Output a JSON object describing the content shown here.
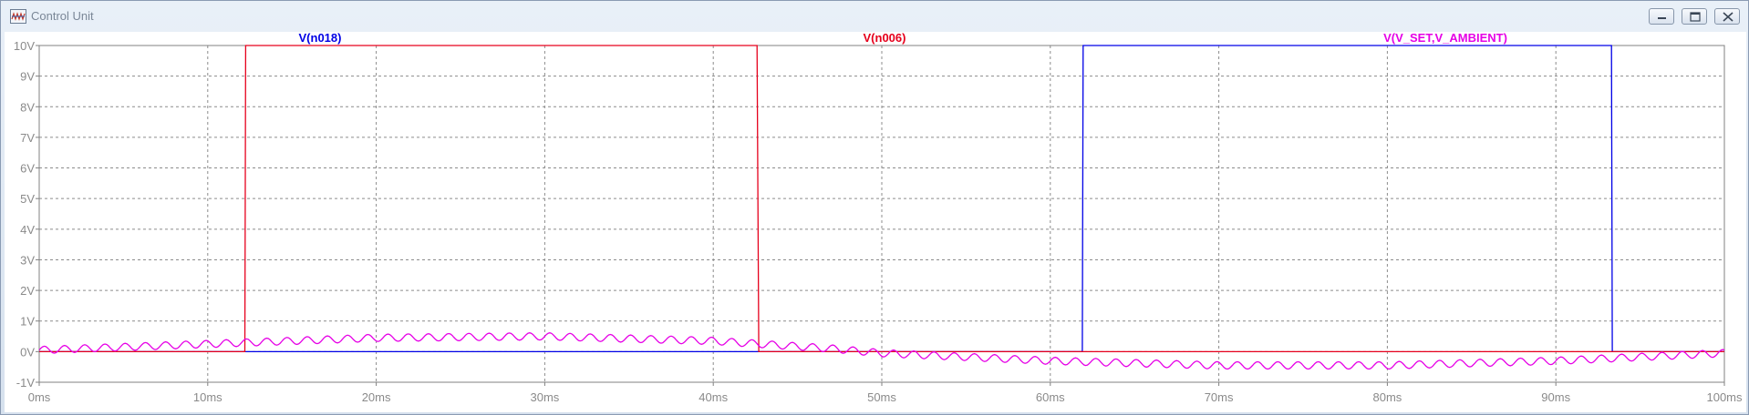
{
  "window": {
    "title": "Control Unit",
    "icons": {
      "app": "waveform-viewer-icon",
      "minimize": "minimize-icon",
      "restore": "restore-icon",
      "close": "close-icon"
    }
  },
  "chart_data": {
    "type": "line",
    "x_unit": "ms",
    "y_unit": "V",
    "xlim": [
      0,
      100
    ],
    "ylim": [
      -1,
      10
    ],
    "x_ticks": [
      0,
      10,
      20,
      30,
      40,
      50,
      60,
      70,
      80,
      90,
      100
    ],
    "x_tick_labels": [
      "0ms",
      "10ms",
      "20ms",
      "30ms",
      "40ms",
      "50ms",
      "60ms",
      "70ms",
      "80ms",
      "90ms",
      "100ms"
    ],
    "y_ticks": [
      -1,
      0,
      1,
      2,
      3,
      4,
      5,
      6,
      7,
      8,
      9,
      10
    ],
    "y_tick_labels": [
      "-1V",
      "0V",
      "1V",
      "2V",
      "3V",
      "4V",
      "5V",
      "6V",
      "7V",
      "8V",
      "9V",
      "10V"
    ],
    "grid": true,
    "legend_placement": "top",
    "series": [
      {
        "name": "V(n018)",
        "color": "#0000e6",
        "kind": "pulse",
        "x": [
          0,
          61.9,
          61.95,
          93.3,
          93.35,
          100
        ],
        "y": [
          0,
          0,
          10,
          10,
          0,
          0
        ]
      },
      {
        "name": "V(n006)",
        "color": "#e6001c",
        "kind": "pulse",
        "x": [
          0,
          12.2,
          12.25,
          42.6,
          42.7,
          100
        ],
        "y": [
          0,
          0,
          10,
          10,
          0,
          0
        ]
      },
      {
        "name": "V(V_SET,V_AMBIENT)",
        "color": "#e600e6",
        "kind": "ripple",
        "x": [
          0,
          10,
          20,
          30,
          40,
          47,
          50,
          60,
          70,
          80,
          90,
          100
        ],
        "y": [
          0.05,
          0.25,
          0.45,
          0.5,
          0.35,
          0.1,
          -0.05,
          -0.3,
          -0.45,
          -0.45,
          -0.3,
          -0.05
        ],
        "ripple_amplitude": 0.12,
        "ripple_period_ms": 1.2
      }
    ]
  }
}
